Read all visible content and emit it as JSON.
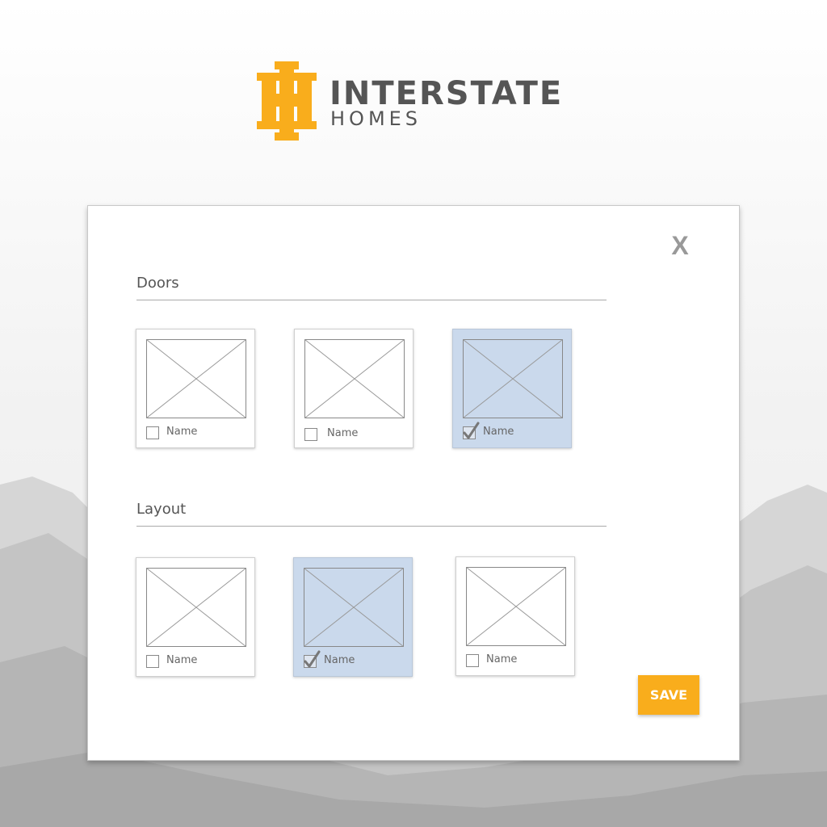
{
  "brand": {
    "line1": "INTERSTATE",
    "line2": "HOMES",
    "accent_color": "#f9ad1c"
  },
  "modal": {
    "close_label": "X",
    "sections": [
      {
        "title": "Doors",
        "items": [
          {
            "label": "Name",
            "checked": false
          },
          {
            "label": "Name",
            "checked": false
          },
          {
            "label": "Name",
            "checked": true
          }
        ]
      },
      {
        "title": "Layout",
        "items": [
          {
            "label": "Name",
            "checked": false
          },
          {
            "label": "Name",
            "checked": true
          },
          {
            "label": "Name",
            "checked": false
          }
        ]
      }
    ],
    "save_label": "SAVE",
    "selected_color": "#cad9ec"
  }
}
